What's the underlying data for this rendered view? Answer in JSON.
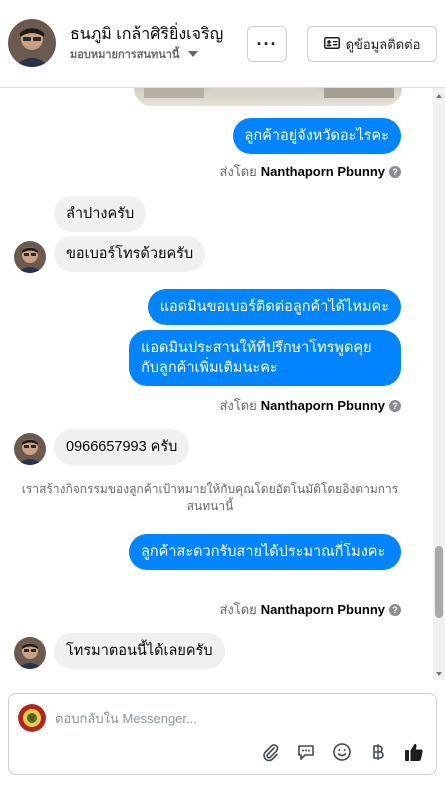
{
  "header": {
    "contact_name": "ธนภูมิ เกล้าศิริยิ่งเจริญ",
    "assigned_label": "มอบหมายการสนทนานี้",
    "more_label": "···",
    "contact_info_label": "ดูข้อมูลติดต่อ"
  },
  "messages": {
    "m1": "ลูกค้าอยู่จังหวัดอะไรคะ",
    "m2": "ลำปางครับ",
    "m3": "ขอเบอร์โทรด้วยครับ",
    "m4": "แอดมินขอเบอร์ติดต่อลูกค้าได้ไหมคะ",
    "m5": "แอดมินประสานให้ที่ปรึกษาโทรพูดคุยกับลูกค้าเพิ่มเติมนะคะ",
    "m6": "0966657993 ครับ",
    "m7": "ลูกค้าสะดวกรับสายได้ประมาณกี่โมงคะ",
    "m8": "โทรมาตอนนี้ได้เลยครับ"
  },
  "sent_by": {
    "prefix": "ส่งโดย",
    "agent": "Nanthaporn Pbunny"
  },
  "system_note": "เราสร้างกิจกรรมของลูกค้าเป้าหมายให้กับคุณโดยอัตโนมัติโดยอิงตามการสนทนานี้",
  "composer": {
    "placeholder": "ตอบกลับใน Messenger..."
  },
  "icons": {
    "attach": "paperclip-icon",
    "gif": "chat-bubble-icon",
    "emoji": "smile-icon",
    "currency": "baht-icon",
    "like": "thumbs-up-icon"
  },
  "colors": {
    "outgoing": "#0084ff",
    "incoming": "#f0f0f0",
    "like": "#1c1e21"
  }
}
